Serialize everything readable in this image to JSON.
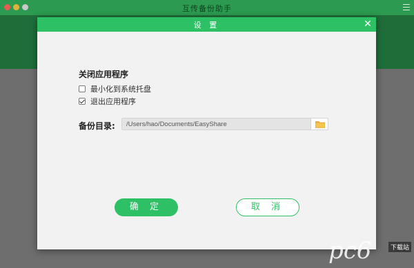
{
  "app": {
    "title": "互传备份助手"
  },
  "dialog": {
    "title": "设 置",
    "close_glyph": "✕",
    "close_section": {
      "title": "关闭应用程序",
      "options": [
        {
          "label": "最小化到系统托盘",
          "checked": false
        },
        {
          "label": "退出应用程序",
          "checked": true
        }
      ]
    },
    "backup_dir": {
      "label": "备份目录:",
      "value": "/Users/hao/Documents/EasyShare"
    },
    "ok_label": "确 定",
    "cancel_label": "取 消"
  },
  "watermark": {
    "logo": "pc6",
    "tag": "下载站"
  },
  "colors": {
    "accent": "#2ec065",
    "app_header": "#1f6e3a"
  },
  "icons": {
    "folder": "folder-icon",
    "close": "close-icon"
  }
}
